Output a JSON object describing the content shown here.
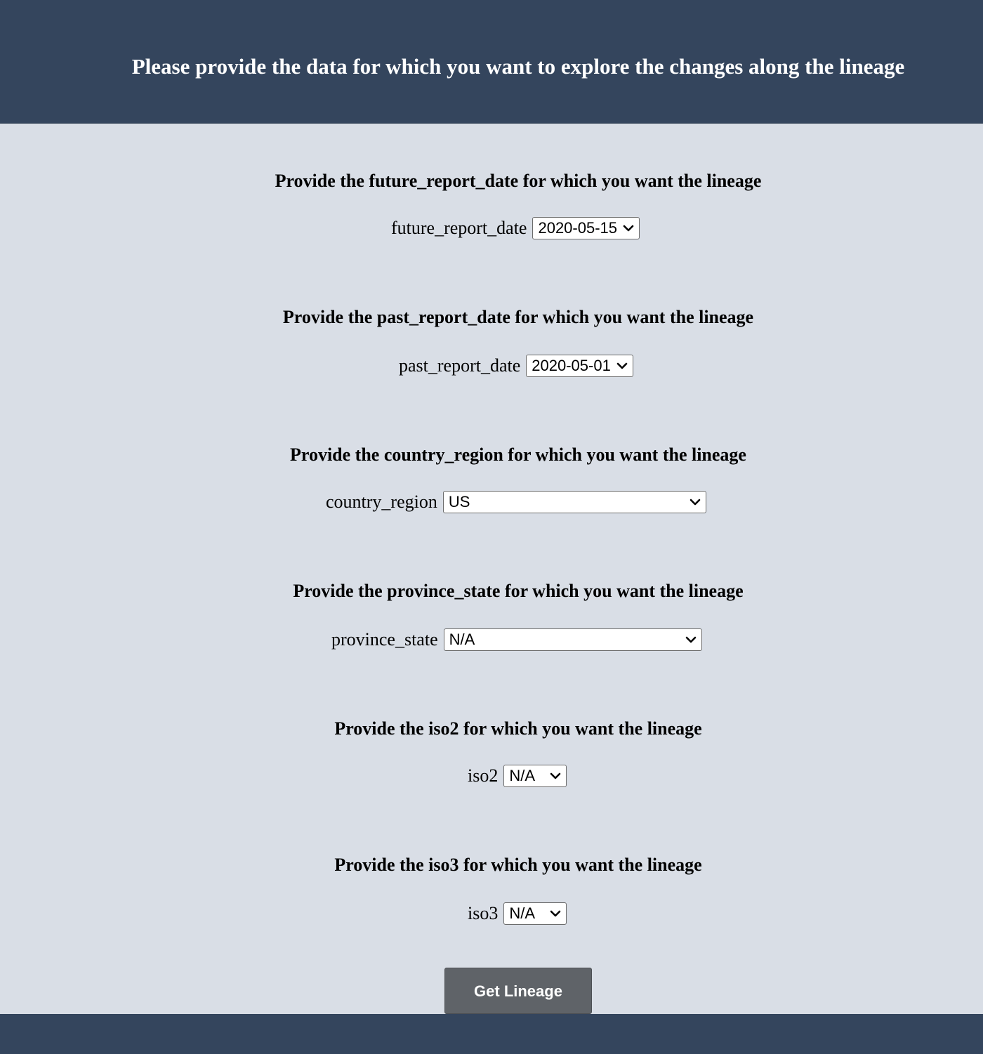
{
  "header": {
    "title": "Please provide the data for which you want to explore the changes along the lineage"
  },
  "fields": [
    {
      "heading": "Provide the future_report_date for which you want the lineage",
      "label": "future_report_date",
      "selected": "2020-05-15"
    },
    {
      "heading": "Provide the past_report_date for which you want the lineage",
      "label": "past_report_date",
      "selected": "2020-05-01"
    },
    {
      "heading": "Provide the country_region for which you want the lineage",
      "label": "country_region",
      "selected": "US"
    },
    {
      "heading": "Provide the province_state for which you want the lineage",
      "label": "province_state",
      "selected": "N/A"
    },
    {
      "heading": "Provide the iso2 for which you want the lineage",
      "label": "iso2",
      "selected": "N/A"
    },
    {
      "heading": "Provide the iso3 for which you want the lineage",
      "label": "iso3",
      "selected": "N/A"
    }
  ],
  "submit": {
    "label": "Get Lineage"
  },
  "icons": {
    "select_arrow": "chevron-down-icon"
  },
  "colors": {
    "header_bg": "#34455d",
    "page_bg": "#d9dee6",
    "button_bg": "#5f6368"
  }
}
